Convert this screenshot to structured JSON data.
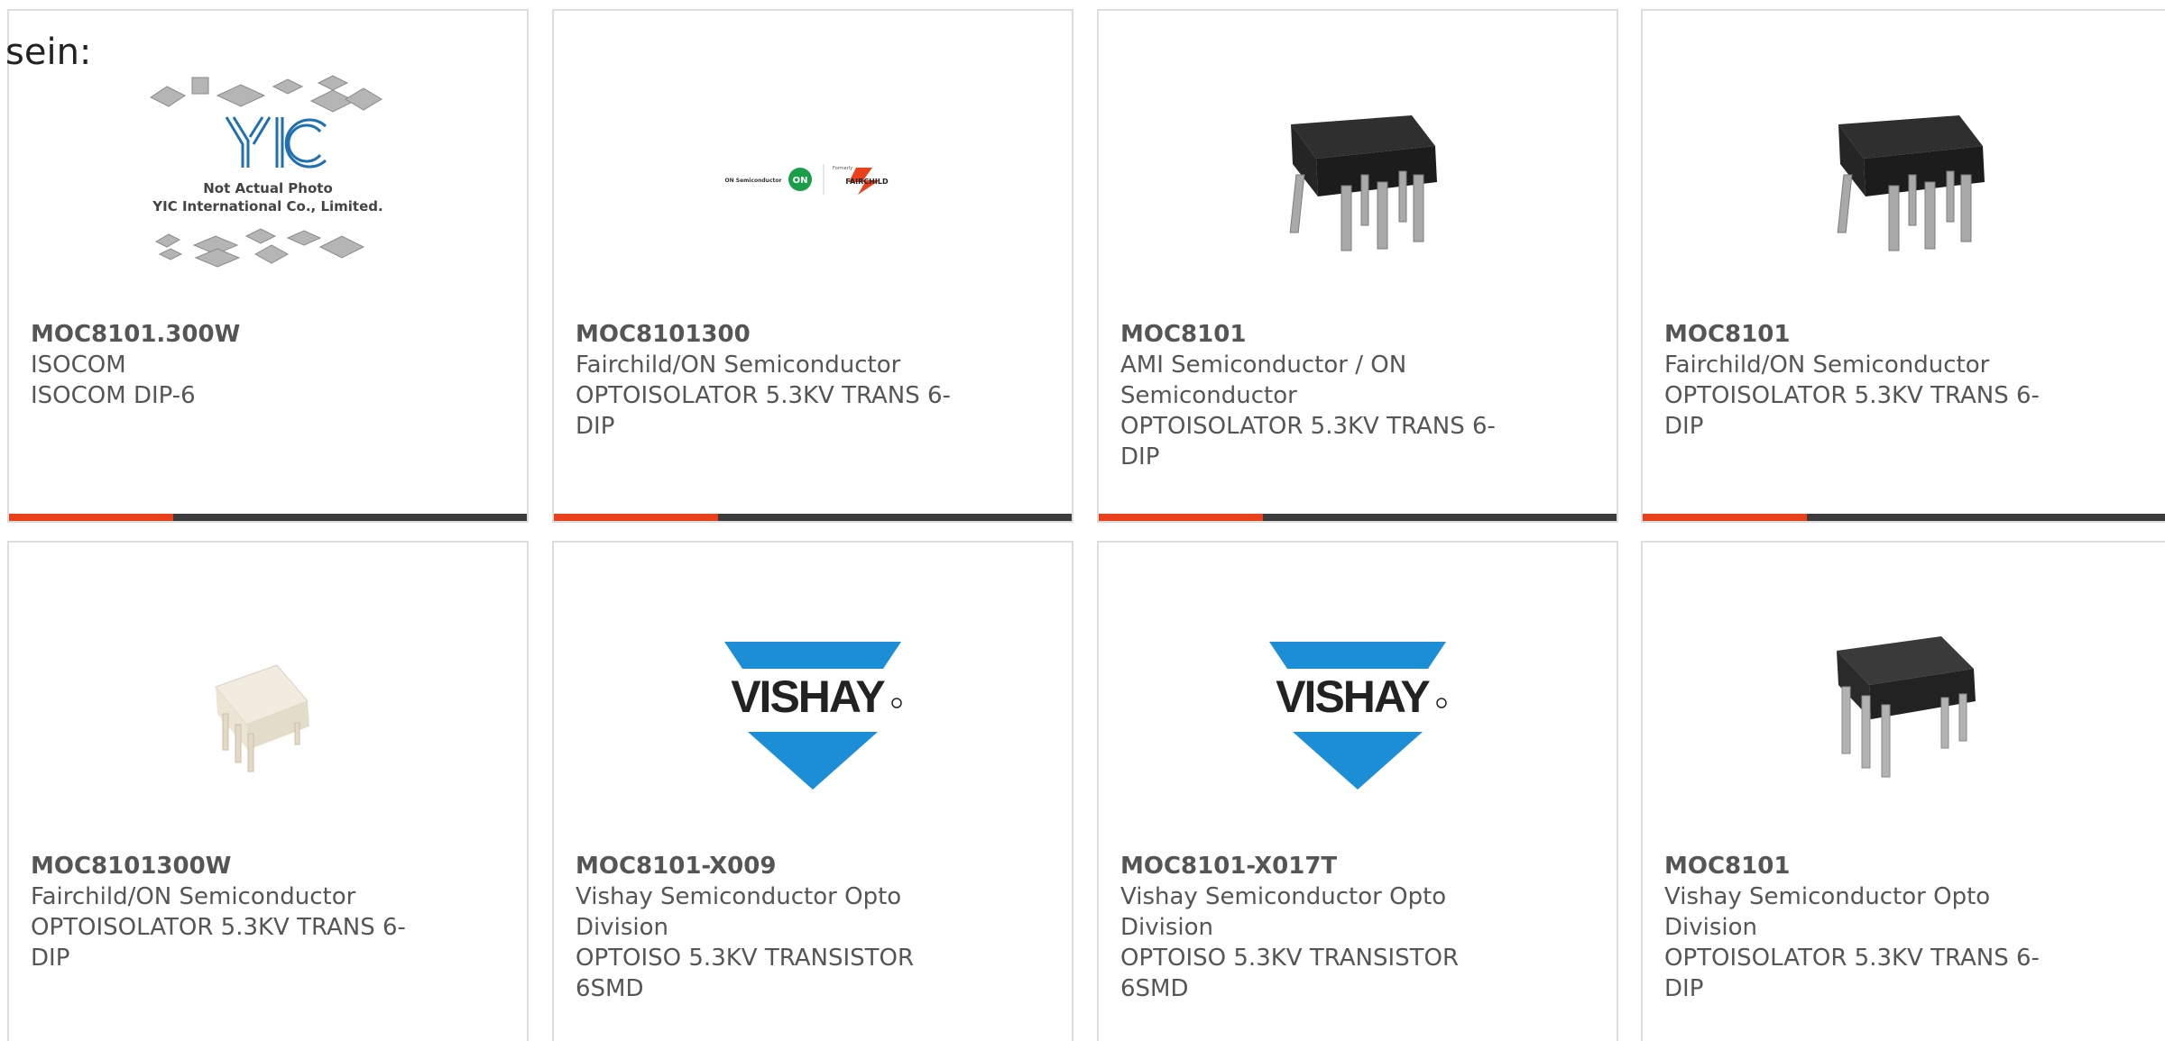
{
  "intro_text": "sein:",
  "colors": {
    "accent": "#e8411c",
    "bar": "#3c3c3c",
    "card_border": "#dddddd",
    "text": "#555555",
    "vishay_blue": "#1b8ed6"
  },
  "cards": [
    {
      "part_number": "MOC8101.300W",
      "manufacturer": "ISOCOM",
      "description": "ISOCOM DIP-6",
      "image": "yic-placeholder",
      "image_text": {
        "line1": "Not Actual Photo",
        "line2": "YIC International Co., Limited."
      }
    },
    {
      "part_number": "MOC8101300",
      "manufacturer": "Fairchild/ON Semiconductor",
      "description": "OPTOISOLATOR 5.3KV TRANS 6-DIP",
      "image": "on-fairchild-logo",
      "image_text": {
        "brand1": "ON Semiconductor",
        "brand2": "Formerly",
        "brand3": "FAIRCHILD"
      }
    },
    {
      "part_number": "MOC8101",
      "manufacturer": "AMI Semiconductor / ON Semiconductor",
      "description": "OPTOISOLATOR 5.3KV TRANS 6-DIP",
      "image": "black-dip6-chip"
    },
    {
      "part_number": "MOC8101",
      "manufacturer": "Fairchild/ON Semiconductor",
      "description": "OPTOISOLATOR 5.3KV TRANS 6-DIP",
      "image": "black-dip6-chip"
    },
    {
      "part_number": "MOC8101300W",
      "manufacturer": "Fairchild/ON Semiconductor",
      "description": "OPTOISOLATOR 5.3KV TRANS 6-DIP",
      "image": "white-dip6-chip"
    },
    {
      "part_number": "MOC8101-X009",
      "manufacturer": "Vishay Semiconductor Opto Division",
      "description": "OPTOISO 5.3KV TRANSISTOR 6SMD",
      "image": "vishay-logo",
      "image_text": {
        "brand": "VISHAY"
      }
    },
    {
      "part_number": "MOC8101-X017T",
      "manufacturer": "Vishay Semiconductor Opto Division",
      "description": "OPTOISO 5.3KV TRANSISTOR 6SMD",
      "image": "vishay-logo",
      "image_text": {
        "brand": "VISHAY"
      }
    },
    {
      "part_number": "MOC8101",
      "manufacturer": "Vishay Semiconductor Opto Division",
      "description": "OPTOISOLATOR 5.3KV TRANS 6-DIP",
      "image": "black-dip6-chip-angled"
    }
  ]
}
